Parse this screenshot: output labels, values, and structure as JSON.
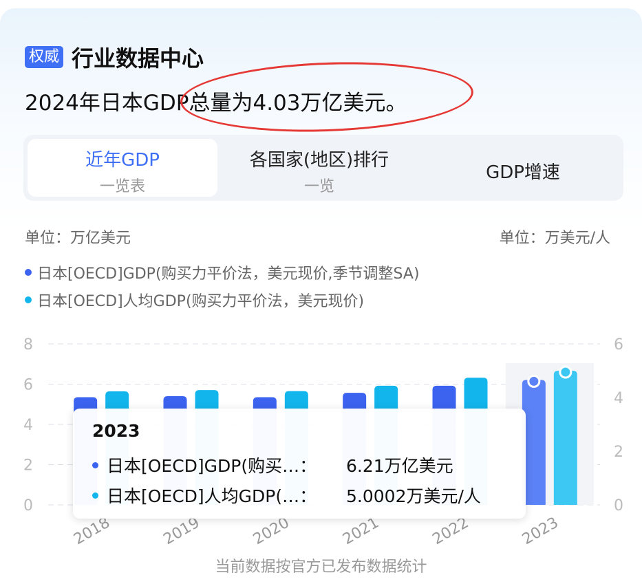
{
  "header": {
    "badge": "权威",
    "title": "行业数据中心"
  },
  "summary": "2024年日本GDP总量为4.03万亿美元。",
  "tabs": [
    {
      "line1": "近年GDP",
      "line2": "一览表",
      "active": true
    },
    {
      "line1": "各国家(地区)排行",
      "line2": "一览",
      "active": false
    },
    {
      "line1": "GDP增速",
      "line2": "",
      "active": false
    }
  ],
  "units": {
    "left": "单位：万亿美元",
    "right": "单位：万美元/人"
  },
  "legend": [
    {
      "label": "日本[OECD]GDP(购买力平价法，美元现价,季节调整SA)",
      "color": "#3b63f0"
    },
    {
      "label": "日本[OECD]人均GDP(购买力平价法，美元现价)",
      "color": "#12b5ec"
    }
  ],
  "chart_data": {
    "type": "bar",
    "categories": [
      "2018",
      "2019",
      "2020",
      "2021",
      "2022",
      "2023"
    ],
    "series": [
      {
        "name": "日本[OECD]GDP(购买力平价法，美元现价,季节调整SA)",
        "axis": "left",
        "color": "#3b63f0",
        "values": [
          5.35,
          5.4,
          5.35,
          5.57,
          5.92,
          6.21
        ]
      },
      {
        "name": "日本[OECD]人均GDP(购买力平价法，美元现价)",
        "axis": "right",
        "color": "#12b5ec",
        "values": [
          4.23,
          4.28,
          4.24,
          4.44,
          4.74,
          5.0002
        ]
      }
    ],
    "y_left": {
      "range": [
        0,
        8
      ],
      "ticks": [
        "0",
        "2",
        "4",
        "6",
        "8"
      ]
    },
    "y_right": {
      "range": [
        0,
        6
      ],
      "ticks": [
        "0",
        "2",
        "4",
        "6"
      ]
    },
    "highlighted_category": "2023",
    "grid": "dashed-horizontal"
  },
  "tooltip": {
    "title": "2023",
    "rows": [
      {
        "label": "日本[OECD]GDP(购买…：",
        "value": "6.21万亿美元",
        "color": "#3b63f0"
      },
      {
        "label": "日本[OECD]人均GDP(…：",
        "value": "5.0002万美元/人",
        "color": "#12b5ec"
      }
    ]
  },
  "footer": "当前数据按官方已发布数据统计"
}
